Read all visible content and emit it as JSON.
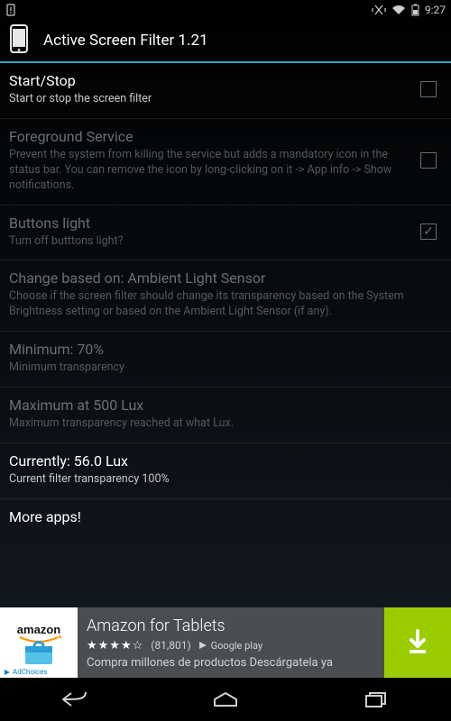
{
  "statusbar": {
    "time": "9:27"
  },
  "appbar": {
    "title": "Active Screen Filter 1.21"
  },
  "items": {
    "startstop": {
      "title": "Start/Stop",
      "sub": "Start or stop the screen filter"
    },
    "foreground": {
      "title": "Foreground Service",
      "sub": "Prevent the system from killing the service but adds a mandatory icon in the status bar. You can remove the icon by long-clicking on it -> App info -> Show notifications."
    },
    "buttonslight": {
      "title": "Buttons light",
      "sub": "Turn off butttons light?"
    },
    "changebased": {
      "title": "Change based on: Ambient Light Sensor",
      "sub": "Choose if the screen filter should change its transparency based on the System Brightness setting or based on the Ambient Light Sensor (if any)."
    },
    "minimum": {
      "title": "Minimum: 70%",
      "sub": "Minimum transparency"
    },
    "maximum": {
      "title": "Maximum at 500 Lux",
      "sub": "Maximum transparency reached at what Lux."
    },
    "currently": {
      "title": "Currently: 56.0 Lux",
      "sub": "Current filter transparency 100%"
    },
    "moreapps": {
      "title": "More apps!"
    }
  },
  "ad": {
    "brand": "amazon",
    "title": "Amazon for Tablets",
    "stars": "★★★★☆",
    "count": "(81,801)",
    "store": "Google play",
    "sub": "Compra millones de productos Descárgatela ya",
    "adchoices": "AdChoices"
  }
}
